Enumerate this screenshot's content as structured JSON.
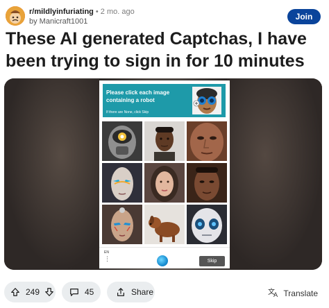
{
  "post": {
    "subreddit": "r/mildlyinfuriating",
    "separator": "•",
    "time": "2 mo. ago",
    "author": "by Manicraft1001",
    "join_label": "Join",
    "title": "These AI generated Captchas, I have been trying to sign in for 10 minutes"
  },
  "captcha": {
    "instruction": "Please click each image containing a robot",
    "hint": "If there are None, click Skip",
    "language": "EN",
    "skip_label": "Skip",
    "tiles": [
      "robot-helmet",
      "man-portrait",
      "man-closeup",
      "android-face",
      "woman-portrait",
      "man-face",
      "cyborg-face",
      "dog-image",
      "robot-mask"
    ]
  },
  "actions": {
    "votes": "249",
    "comments": "45",
    "share": "Share",
    "translate": "Translate"
  },
  "colors": {
    "join_button": "#0a449b",
    "captcha_header": "#1e9aa9",
    "pill_bg": "#eaedef"
  }
}
